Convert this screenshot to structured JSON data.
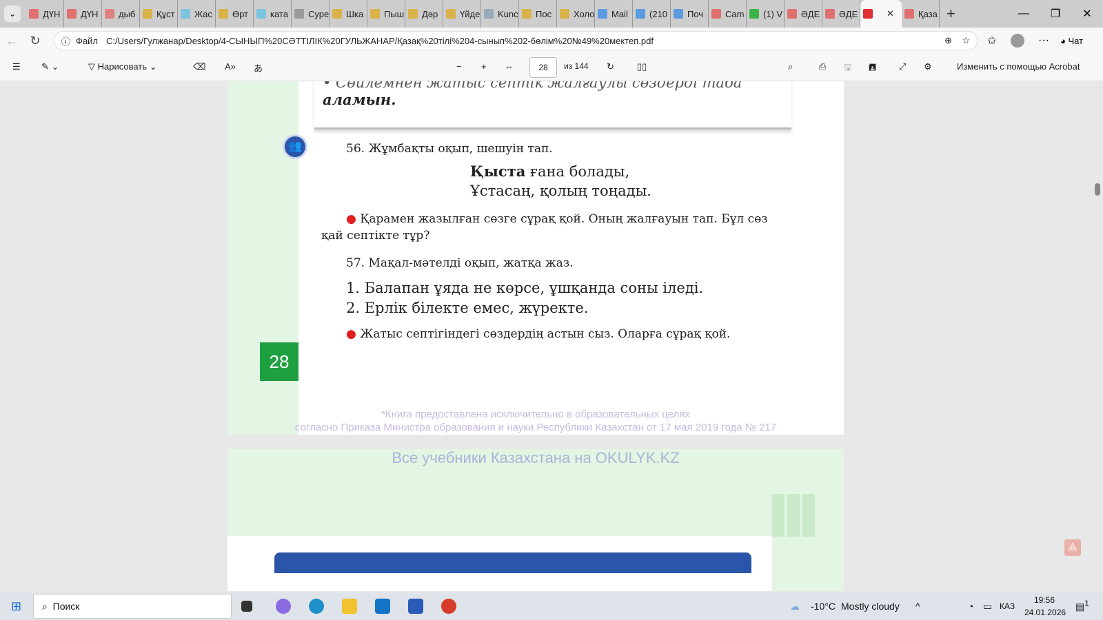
{
  "tabs": [
    "ДҮН",
    "ДҮН",
    "дыб",
    "Құст",
    "Жас",
    "Өрт",
    "ката",
    "Суре",
    "Шка",
    "Пыш",
    "Дәр",
    "Үйде",
    "Kunc",
    "Пос",
    "Холо",
    "Mail",
    "(210",
    "Поч",
    "Cam",
    "(1) V",
    "ӘДЕ",
    "ӘДЕ",
    "",
    "Қаза"
  ],
  "active_tab": 22,
  "address": {
    "scheme_label": "Файл",
    "url": "C:/Users/Гулжанар/Desktop/4-СЫНЫП%20СӘТТІЛІК%20ГУЛЬЖАНАР/Қазақ%20тілі%204-сынып%202-бөлім%20№49%20мектеп.pdf",
    "chat_label": "Чат"
  },
  "toolbar": {
    "draw_label": "Нарисовать",
    "page_current": "28",
    "page_total": "из 144",
    "acrobat_label": "Изменить с помощью Acrobat"
  },
  "page": {
    "top_line1": "• Сөйлемнен жатыс септік жалғаулы сөздерді таба",
    "top_line2": "аламын.",
    "ex56": "56. Жұмбақты оқып, шешуін тап.",
    "riddle_bold": "Қыста",
    "riddle_rest": " ғана болады,",
    "riddle_line2": "Ұстасаң, қолың тоңады.",
    "task1": "Қарамен жазылған сөзге сұрақ қой. Оның жалғауын тап. Бұл сөз",
    "task1b": "қай септікте тұр?",
    "ex57": "57. Мақал-мәтелді оқып, жатқа жаз.",
    "proverb1": "1. Балапан ұяда не көрсе, ұшқанда соны іледі.",
    "proverb2": "2. Ерлік білекте емес, жүректе.",
    "task2": "Жатыс септігіндегі сөздердің астын сыз. Оларға сұрақ қой.",
    "page_number": "28",
    "disclaimer1": "*Книга предоставлена исключительно в образовательных целях",
    "disclaimer2": "согласно Приказа Министра образования и науки Республики Казахстан от 17 мая 2019 года № 217",
    "watermark": "Все учебники Казахстана на OKULYK.KZ"
  },
  "taskbar": {
    "search": "Поиск",
    "weather_temp": "-10°C",
    "weather_text": "Mostly cloudy",
    "lang": "КАЗ",
    "time": "19:56",
    "date": "24.01.2026",
    "notif": "1"
  },
  "colors": {
    "page_green": "#e3f5e3",
    "number_box": "#1fa040",
    "accent_blue": "#2a55a8"
  }
}
